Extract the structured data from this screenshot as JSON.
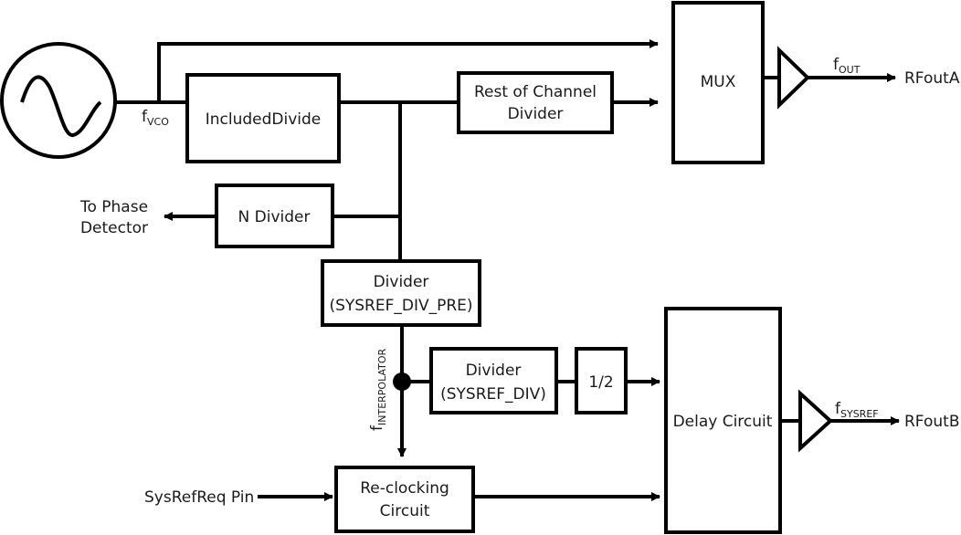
{
  "diagram": {
    "oscillator": {
      "icon": "sine-wave-icon"
    },
    "signals": {
      "fvco": {
        "base": "f",
        "sub": "VCO"
      },
      "fout": {
        "base": "f",
        "sub": "OUT"
      },
      "fsysref": {
        "base": "f",
        "sub": "SYSREF"
      },
      "finterpolator": {
        "base": "f",
        "sub": "INTERPOLATOR"
      }
    },
    "blocks": {
      "included_divide": "IncludedDivide",
      "rest_channel_1": "Rest of Channel",
      "rest_channel_2": "Divider",
      "mux": "MUX",
      "n_divider": "N Divider",
      "sysref_div_pre_1": "Divider",
      "sysref_div_pre_2": "(SYSREF_DIV_PRE)",
      "sysref_div_1": "Divider",
      "sysref_div_2": "(SYSREF_DIV)",
      "half": "1/2",
      "delay": "Delay Circuit",
      "reclock_1": "Re-clocking",
      "reclock_2": "Circuit"
    },
    "ports": {
      "phase_detector_1": "To Phase",
      "phase_detector_2": "Detector",
      "rfouta": "RFoutA",
      "rfoutb": "RFoutB",
      "sysrefreq": "SysRefReq Pin"
    }
  }
}
